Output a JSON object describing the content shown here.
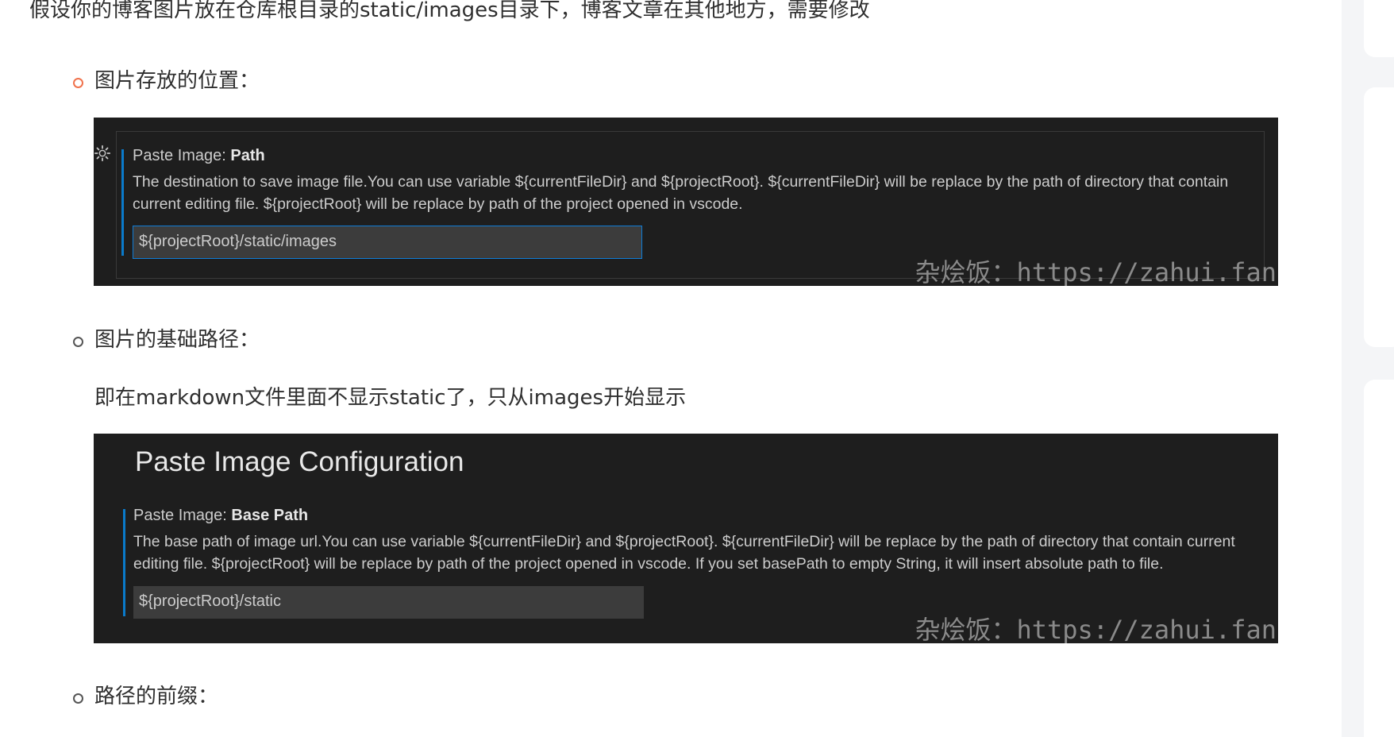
{
  "intro": "假设你的博客图片放在仓库根目录的static/images目录下，博客文章在其他地方，需要修改",
  "items": [
    {
      "label": "图片存放的位置："
    },
    {
      "label": "图片的基础路径：",
      "note": "即在markdown文件里面不显示static了，只从images开始显示"
    },
    {
      "label": "路径的前缀："
    }
  ],
  "screenshot1": {
    "title_prefix": "Paste Image: ",
    "title_name": "Path",
    "description": "The destination to save image file.You can use variable ${currentFileDir} and ${projectRoot}. ${currentFileDir} will be replace by the path of directory that contain current editing file. ${projectRoot} will be replace by path of the project opened in vscode.",
    "value": "${projectRoot}/static/images",
    "watermark": "杂烩饭：https://zahui.fan"
  },
  "screenshot2": {
    "heading": "Paste Image Configuration",
    "title_prefix": "Paste Image: ",
    "title_name": "Base Path",
    "description": "The base path of image url.You can use variable ${currentFileDir} and ${projectRoot}. ${currentFileDir} will be replace by the path of directory that contain current editing file. ${projectRoot} will be replace by path of the project opened in vscode. If you set basePath to empty String, it will insert absolute path to file.",
    "value": "${projectRoot}/static",
    "watermark": "杂烩饭：https://zahui.fan"
  },
  "colors": {
    "bullet_first": "#f0724c",
    "bullet_default": "#555555",
    "vscode_bg": "#1e1e1e",
    "vscode_accent": "#0a7aca"
  }
}
